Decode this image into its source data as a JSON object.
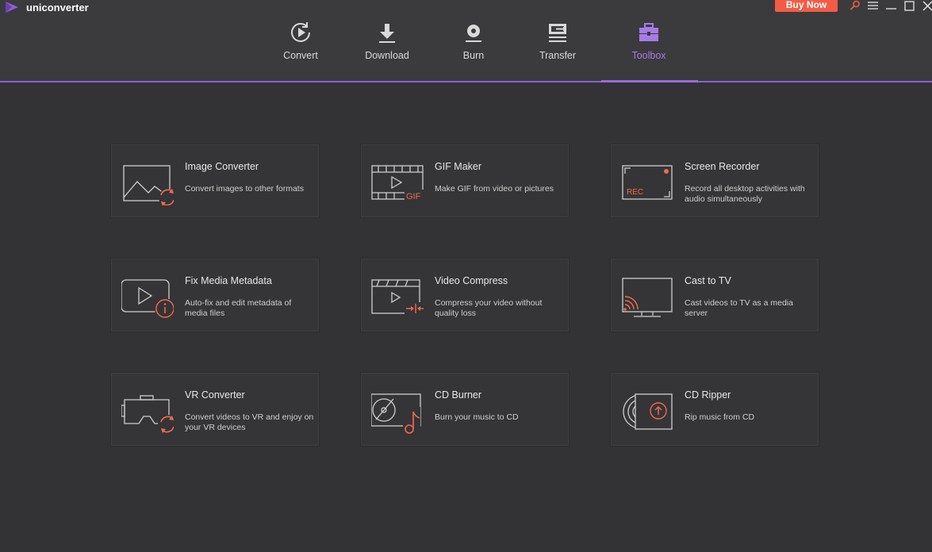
{
  "app": {
    "title": "uniconverter",
    "buy_label": "Buy Now"
  },
  "nav": {
    "items": [
      {
        "label": "Convert",
        "icon": "convert-icon"
      },
      {
        "label": "Download",
        "icon": "download-icon"
      },
      {
        "label": "Burn",
        "icon": "burn-icon"
      },
      {
        "label": "Transfer",
        "icon": "transfer-icon"
      },
      {
        "label": "Toolbox",
        "icon": "toolbox-icon",
        "active": true
      }
    ]
  },
  "tools": [
    {
      "title": "Image Converter",
      "desc": "Convert images to other formats",
      "icon": "image-converter-icon"
    },
    {
      "title": "GIF Maker",
      "desc": "Make GIF from video or pictures",
      "icon": "gif-maker-icon",
      "icon_text": "GIF"
    },
    {
      "title": "Screen Recorder",
      "desc": "Record all desktop activities with audio simultaneously",
      "icon": "screen-recorder-icon",
      "icon_text": "REC"
    },
    {
      "title": "Fix Media Metadata",
      "desc": "Auto-fix and edit metadata of media files",
      "icon": "fix-metadata-icon"
    },
    {
      "title": "Video Compress",
      "desc": "Compress your video without quality loss",
      "icon": "video-compress-icon"
    },
    {
      "title": "Cast to TV",
      "desc": "Cast videos to TV as a media server",
      "icon": "cast-tv-icon"
    },
    {
      "title": "VR Converter",
      "desc": "Convert videos to VR and enjoy on your VR devices",
      "icon": "vr-converter-icon"
    },
    {
      "title": "CD Burner",
      "desc": "Burn your music to CD",
      "icon": "cd-burner-icon"
    },
    {
      "title": "CD Ripper",
      "desc": "Rip music from CD",
      "icon": "cd-ripper-icon"
    }
  ],
  "colors": {
    "accent": "#9a6ae0",
    "buy": "#f25c46",
    "icon_accent": "#f06a4e"
  }
}
